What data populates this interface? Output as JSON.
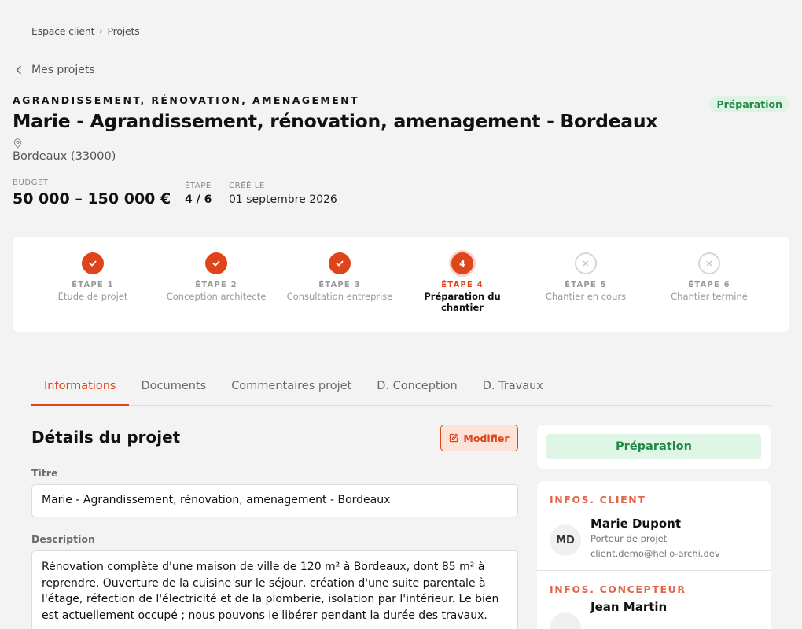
{
  "breadcrumb": {
    "root": "Espace client",
    "current": "Projets"
  },
  "back_link": "Mes projets",
  "project": {
    "kicker": "AGRANDISSEMENT, RÉNOVATION, AMENAGEMENT",
    "title": "Marie - Agrandissement, rénovation, amenagement - Bordeaux",
    "status": "Préparation",
    "location": "Bordeaux (33000)",
    "budget_label": "BUDGET",
    "budget": "50 000 – 150 000 €",
    "step_label": "ÉTAPE",
    "step": "4 / 6",
    "created_label": "CRÉÉ LE",
    "created": "01 septembre 2026"
  },
  "stepper": {
    "current_step": 4,
    "steps": [
      {
        "label": "ÉTAPE 1",
        "name": "Étude de projet",
        "state": "done"
      },
      {
        "label": "ÉTAPE 2",
        "name": "Conception architecte",
        "state": "done"
      },
      {
        "label": "ÉTAPE 3",
        "name": "Consultation entreprise",
        "state": "done"
      },
      {
        "label": "ÉTAPE 4",
        "name": "Préparation du chantier",
        "state": "current",
        "number": "4"
      },
      {
        "label": "ÉTAPE 5",
        "name": "Chantier en cours",
        "state": "todo"
      },
      {
        "label": "ÉTAPE 6",
        "name": "Chantier terminé",
        "state": "todo"
      }
    ]
  },
  "tabs": [
    "Informations",
    "Documents",
    "Commentaires projet",
    "D. Conception",
    "D. Travaux"
  ],
  "details": {
    "section_title": "Détails du projet",
    "edit_label": "Modifier",
    "title_label": "Titre",
    "title_value": "Marie - Agrandissement, rénovation, amenagement - Bordeaux",
    "description_label": "Description",
    "description_value": "Rénovation complète d'une maison de ville de 120 m² à Bordeaux, dont 85 m² à reprendre. Ouverture de la cuisine sur le séjour, création d'une suite parentale à l'étage, réfection de l'électricité et de la plomberie, isolation par l'intérieur. Le bien est actuellement occupé ; nous pouvons le libérer pendant la durée des travaux."
  },
  "sidebar": {
    "status": "Préparation",
    "client_title": "INFOS. CLIENT",
    "client": {
      "initials": "MD",
      "name": "Marie Dupont",
      "role": "Porteur de projet",
      "email": "client.demo@hello-archi.dev"
    },
    "designer_title": "INFOS. CONCEPTEUR",
    "designer": {
      "name": "Jean Martin"
    }
  },
  "colors": {
    "accent": "#e0441a",
    "success": "#1f8a46",
    "success_bg": "#dff5e5",
    "background": "#f3f3f3"
  }
}
